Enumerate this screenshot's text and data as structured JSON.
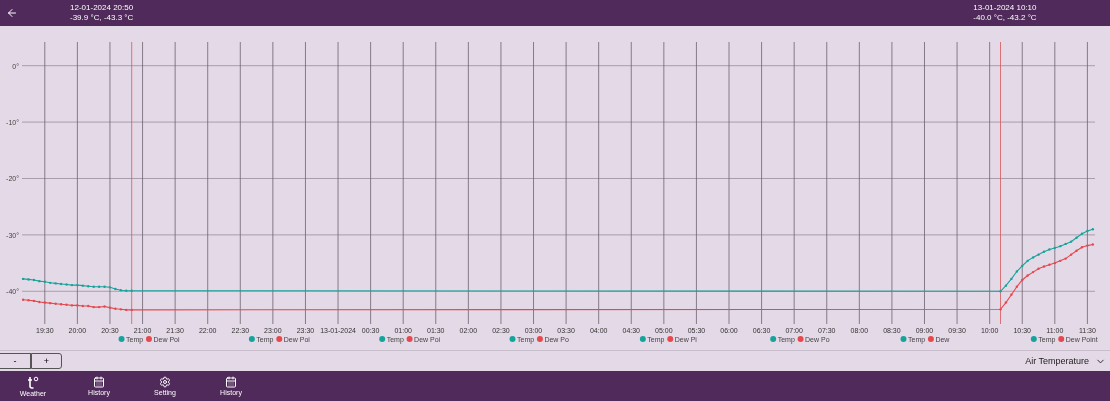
{
  "header": {
    "readouts": [
      {
        "datetime": "12-01-2024 20:50",
        "values": "-39.9 °C, -43.3 °C"
      },
      {
        "datetime": "13-01-2024 10:10",
        "values": "-40.0 °C, -43.2 °C"
      }
    ]
  },
  "chart": {
    "chart_data": {
      "type": "line",
      "grid": true,
      "legend": "bottom",
      "xlim": [
        "2024-01-12T19:09",
        "2024-01-13T11:37"
      ],
      "ylim": [
        -45.8,
        4.2
      ],
      "yticks": [
        {
          "value": 0,
          "label": "0°"
        },
        {
          "value": -10,
          "label": "-10°"
        },
        {
          "value": -20,
          "label": "-20°"
        },
        {
          "value": -30,
          "label": "-30°"
        },
        {
          "value": -40,
          "label": "-40°"
        }
      ],
      "xticks": [
        {
          "value": "2024-01-12T19:30",
          "label": "19:30"
        },
        {
          "value": "2024-01-12T20:00",
          "label": "20:00"
        },
        {
          "value": "2024-01-12T20:30",
          "label": "20:30"
        },
        {
          "value": "2024-01-12T21:00",
          "label": "21:00"
        },
        {
          "value": "2024-01-12T21:30",
          "label": "21:30"
        },
        {
          "value": "2024-01-12T22:00",
          "label": "22:00"
        },
        {
          "value": "2024-01-12T22:30",
          "label": "22:30"
        },
        {
          "value": "2024-01-12T23:00",
          "label": "23:00"
        },
        {
          "value": "2024-01-12T23:30",
          "label": "23:30"
        },
        {
          "value": "2024-01-13T00:00",
          "label": "13-01-2024"
        },
        {
          "value": "2024-01-13T00:30",
          "label": "00:30"
        },
        {
          "value": "2024-01-13T01:00",
          "label": "01:00"
        },
        {
          "value": "2024-01-13T01:30",
          "label": "01:30"
        },
        {
          "value": "2024-01-13T02:00",
          "label": "02:00"
        },
        {
          "value": "2024-01-13T02:30",
          "label": "02:30"
        },
        {
          "value": "2024-01-13T03:00",
          "label": "03:00"
        },
        {
          "value": "2024-01-13T03:30",
          "label": "03:30"
        },
        {
          "value": "2024-01-13T04:00",
          "label": "04:00"
        },
        {
          "value": "2024-01-13T04:30",
          "label": "04:30"
        },
        {
          "value": "2024-01-13T05:00",
          "label": "05:00"
        },
        {
          "value": "2024-01-13T05:30",
          "label": "05:30"
        },
        {
          "value": "2024-01-13T06:00",
          "label": "06:00"
        },
        {
          "value": "2024-01-13T06:30",
          "label": "06:30"
        },
        {
          "value": "2024-01-13T07:00",
          "label": "07:00"
        },
        {
          "value": "2024-01-13T07:30",
          "label": "07:30"
        },
        {
          "value": "2024-01-13T08:00",
          "label": "08:00"
        },
        {
          "value": "2024-01-13T08:30",
          "label": "08:30"
        },
        {
          "value": "2024-01-13T09:00",
          "label": "09:00"
        },
        {
          "value": "2024-01-13T09:30",
          "label": "09:30"
        },
        {
          "value": "2024-01-13T10:00",
          "label": "10:00"
        },
        {
          "value": "2024-01-13T10:30",
          "label": "10:30"
        },
        {
          "value": "2024-01-13T11:00",
          "label": "11:00"
        },
        {
          "value": "2024-01-13T11:30",
          "label": "11:30"
        }
      ],
      "x": [
        "2024-01-12T19:10",
        "2024-01-12T19:15",
        "2024-01-12T19:20",
        "2024-01-12T19:25",
        "2024-01-12T19:30",
        "2024-01-12T19:35",
        "2024-01-12T19:40",
        "2024-01-12T19:45",
        "2024-01-12T19:50",
        "2024-01-12T19:55",
        "2024-01-12T20:00",
        "2024-01-12T20:05",
        "2024-01-12T20:10",
        "2024-01-12T20:15",
        "2024-01-12T20:20",
        "2024-01-12T20:25",
        "2024-01-12T20:30",
        "2024-01-12T20:35",
        "2024-01-12T20:40",
        "2024-01-12T20:45",
        "2024-01-12T20:50",
        "2024-01-13T10:10",
        "2024-01-13T10:15",
        "2024-01-13T10:20",
        "2024-01-13T10:25",
        "2024-01-13T10:30",
        "2024-01-13T10:35",
        "2024-01-13T10:40",
        "2024-01-13T10:45",
        "2024-01-13T10:50",
        "2024-01-13T10:55",
        "2024-01-13T11:00",
        "2024-01-13T11:05",
        "2024-01-13T11:10",
        "2024-01-13T11:15",
        "2024-01-13T11:20",
        "2024-01-13T11:25",
        "2024-01-13T11:30",
        "2024-01-13T11:35"
      ],
      "series": [
        {
          "name": "Temp",
          "color": "#16a39b",
          "values": [
            -37.8,
            -37.9,
            -38.0,
            -38.2,
            -38.3,
            -38.5,
            -38.6,
            -38.7,
            -38.8,
            -38.9,
            -38.9,
            -39.0,
            -39.1,
            -39.2,
            -39.2,
            -39.2,
            -39.3,
            -39.6,
            -39.8,
            -39.9,
            -39.9,
            -40.0,
            -39.0,
            -37.8,
            -36.5,
            -35.5,
            -34.6,
            -34.0,
            -33.5,
            -33.0,
            -32.6,
            -32.3,
            -32.0,
            -31.6,
            -31.2,
            -30.5,
            -29.8,
            -29.3,
            -29.0
          ]
        },
        {
          "name": "Dew Point",
          "color": "#e5484d",
          "values": [
            -41.5,
            -41.6,
            -41.7,
            -41.9,
            -42.0,
            -42.1,
            -42.2,
            -42.3,
            -42.4,
            -42.5,
            -42.5,
            -42.6,
            -42.6,
            -42.8,
            -42.8,
            -42.7,
            -42.9,
            -43.1,
            -43.2,
            -43.3,
            -43.3,
            -43.2,
            -42.0,
            -40.6,
            -39.2,
            -38.0,
            -37.2,
            -36.6,
            -36.0,
            -35.6,
            -35.3,
            -35.0,
            -34.6,
            -34.2,
            -33.5,
            -32.8,
            -32.2,
            -31.9,
            -31.7
          ]
        }
      ],
      "ref_lines": [
        {
          "axis": "x",
          "value": "2024-01-12T20:50"
        },
        {
          "axis": "x",
          "value": "2024-01-13T10:10"
        }
      ]
    },
    "legends": [
      [
        {
          "label": "Temp",
          "color": "#16a39b"
        },
        {
          "label": "Dew Poi",
          "color": "#e5484d"
        }
      ],
      [
        {
          "label": "Temp",
          "color": "#16a39b"
        },
        {
          "label": "Dew Poi",
          "color": "#e5484d"
        }
      ],
      [
        {
          "label": "Temp",
          "color": "#16a39b"
        },
        {
          "label": "Dew Poi",
          "color": "#e5484d"
        }
      ],
      [
        {
          "label": "Temp",
          "color": "#16a39b"
        },
        {
          "label": "Dew Po",
          "color": "#e5484d"
        }
      ],
      [
        {
          "label": "Temp",
          "color": "#16a39b"
        },
        {
          "label": "Dew Pi",
          "color": "#e5484d"
        }
      ],
      [
        {
          "label": "Temp",
          "color": "#16a39b"
        },
        {
          "label": "Dew Po",
          "color": "#e5484d"
        }
      ],
      [
        {
          "label": "Temp",
          "color": "#16a39b"
        },
        {
          "label": "Dew",
          "color": "#e5484d"
        }
      ]
    ]
  },
  "controls": {
    "zoom_buttons": [
      "-",
      "+"
    ],
    "dropdown": {
      "value": "Air Temperature"
    }
  },
  "nav": [
    {
      "kind": "thermo",
      "label": "Weather"
    },
    {
      "kind": "calendar",
      "label": "History"
    },
    {
      "kind": "gear",
      "label": "Setting"
    },
    {
      "kind": "calendar",
      "label": "History"
    }
  ]
}
